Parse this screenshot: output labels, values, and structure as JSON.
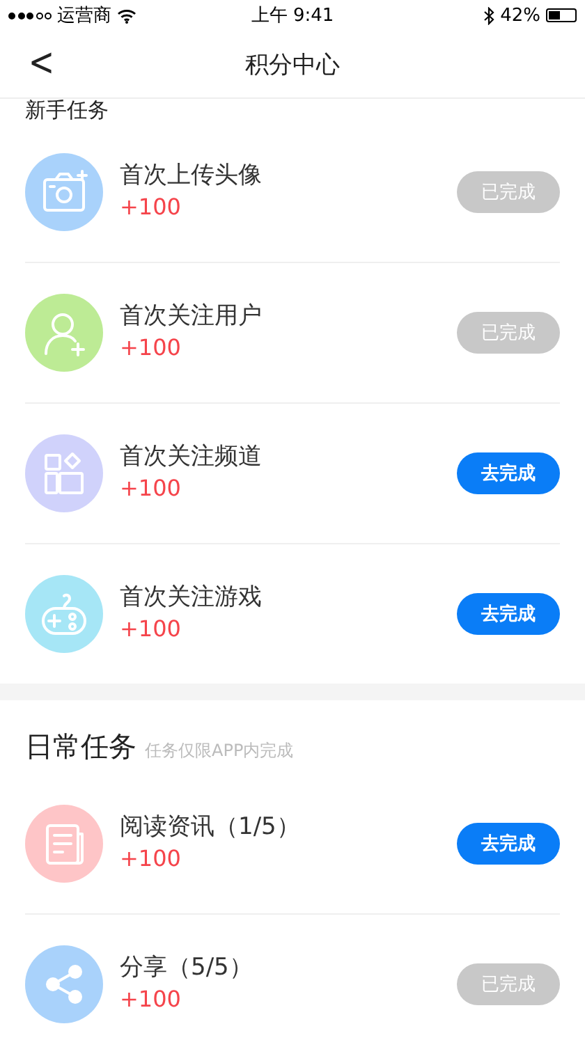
{
  "status_bar": {
    "carrier": "运营商",
    "time": "上午 9:41",
    "battery": "42%"
  },
  "nav": {
    "back": "<",
    "title": "积分中心"
  },
  "sections": [
    {
      "title": "新手任务",
      "tasks": [
        {
          "kind": "camera",
          "color": "#a9d2fb",
          "name": "首次上传头像",
          "points": "+100",
          "button": "已完成",
          "done": true
        },
        {
          "kind": "follow",
          "color": "#bdeb95",
          "name": "首次关注用户",
          "points": "+100",
          "button": "已完成",
          "done": true
        },
        {
          "kind": "channel",
          "color": "#d0d2fb",
          "name": "首次关注频道",
          "points": "+100",
          "button": "去完成",
          "done": false
        },
        {
          "kind": "game",
          "color": "#a6e6f6",
          "name": "首次关注游戏",
          "points": "+100",
          "button": "去完成",
          "done": false
        }
      ]
    },
    {
      "title": "日常任务",
      "note": "任务仅限APP内完成",
      "tasks": [
        {
          "kind": "reading",
          "color": "#fec5c7",
          "name": "阅读资讯（1/5）",
          "points": "+100",
          "button": "去完成",
          "done": false
        },
        {
          "kind": "share",
          "color": "#a9d2fb",
          "name": "分享（5/5）",
          "points": "+100",
          "button": "已完成",
          "done": true
        }
      ]
    }
  ]
}
